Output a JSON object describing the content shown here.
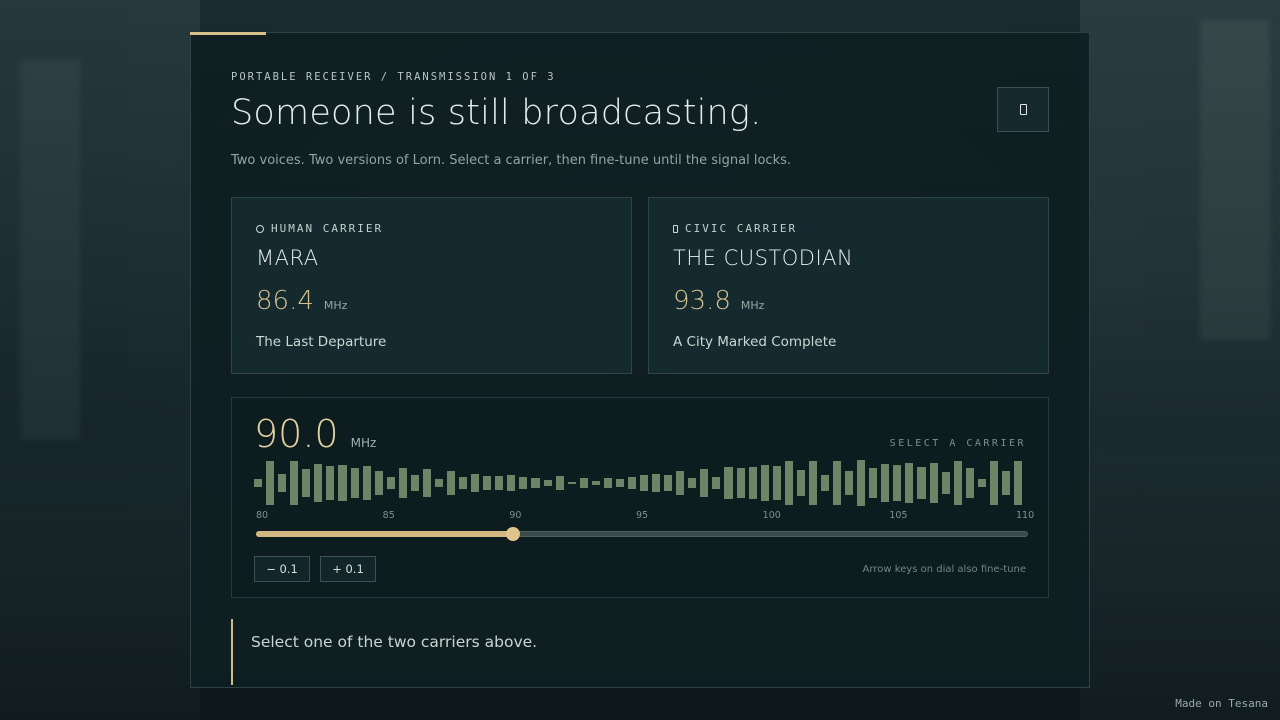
{
  "header": {
    "kicker": "PORTABLE RECEIVER / TRANSMISSION 1 OF 3",
    "title": "Someone is still broadcasting.",
    "subtitle": "Two voices. Two versions of Lorn. Select a carrier, then fine-tune until the signal locks."
  },
  "corner_button": {
    "icon": "rectangle-icon"
  },
  "carriers": [
    {
      "tag": "HUMAN CARRIER",
      "icon": "circle-icon",
      "name": "MARA",
      "freq": "86.4",
      "unit": "MHz",
      "song": "The Last Departure"
    },
    {
      "tag": "CIVIC CARRIER",
      "icon": "rectangle-icon",
      "name": "THE CUSTODIAN",
      "freq": "93.8",
      "unit": "MHz",
      "song": "A City Marked Complete"
    }
  ],
  "tuner": {
    "freq": "90.0",
    "unit": "MHz",
    "status": "SELECT A CARRIER",
    "ticks": [
      "80",
      "85",
      "90",
      "95",
      "100",
      "105",
      "110"
    ],
    "min": 80,
    "max": 110,
    "value": 90.0,
    "minus_label": "− 0.1",
    "plus_label": "+ 0.1",
    "hint": "Arrow keys on dial also fine-tune",
    "spectrum_levels": [
      0.17,
      0.95,
      0.4,
      0.95,
      0.62,
      0.84,
      0.73,
      0.78,
      0.66,
      0.72,
      0.51,
      0.28,
      0.64,
      0.33,
      0.6,
      0.16,
      0.54,
      0.24,
      0.38,
      0.32,
      0.3,
      0.33,
      0.26,
      0.23,
      0.11,
      0.3,
      0.06,
      0.22,
      0.1,
      0.22,
      0.19,
      0.25,
      0.33,
      0.38,
      0.34,
      0.51,
      0.2,
      0.6,
      0.24,
      0.71,
      0.66,
      0.7,
      0.79,
      0.76,
      0.95,
      0.56,
      0.95,
      0.33,
      0.95,
      0.53,
      0.99,
      0.64,
      0.82,
      0.79,
      0.87,
      0.7,
      0.85,
      0.48,
      0.97,
      0.65,
      0.16,
      0.97,
      0.51,
      0.95
    ]
  },
  "footer": {
    "message": "Select one of the two carriers above."
  },
  "watermark": "Made on Tesana",
  "colors": {
    "accent": "#d8c08a",
    "frequency": "#d2bf8f",
    "spectrum": "#6e8466",
    "panel": "#0e1e22"
  }
}
